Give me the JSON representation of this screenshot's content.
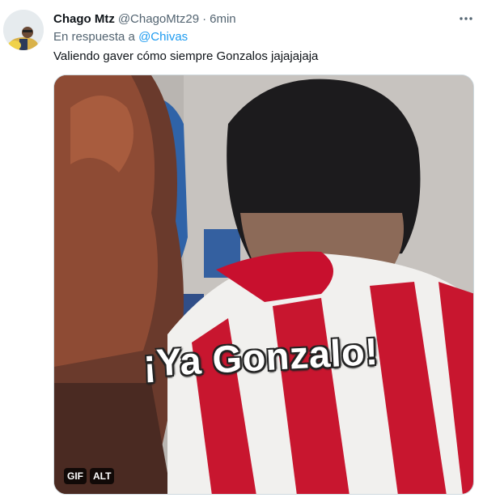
{
  "tweet": {
    "author_name": "Chago Mtz",
    "handle": "@ChagoMtz29",
    "separator": "·",
    "time": "6min",
    "reply_prefix": "En respuesta a",
    "reply_mention": "@Chivas",
    "text": "Valiendo gaver cómo siempre Gonzalos jajajajaja",
    "more_icon": "more-horizontal-icon"
  },
  "media": {
    "caption": "¡Ya Gonzalo!",
    "gif_badge": "GIF",
    "alt_badge": "ALT"
  },
  "colors": {
    "link": "#1d9bf0",
    "secondary_text": "#536471",
    "primary_text": "#0f1419"
  }
}
